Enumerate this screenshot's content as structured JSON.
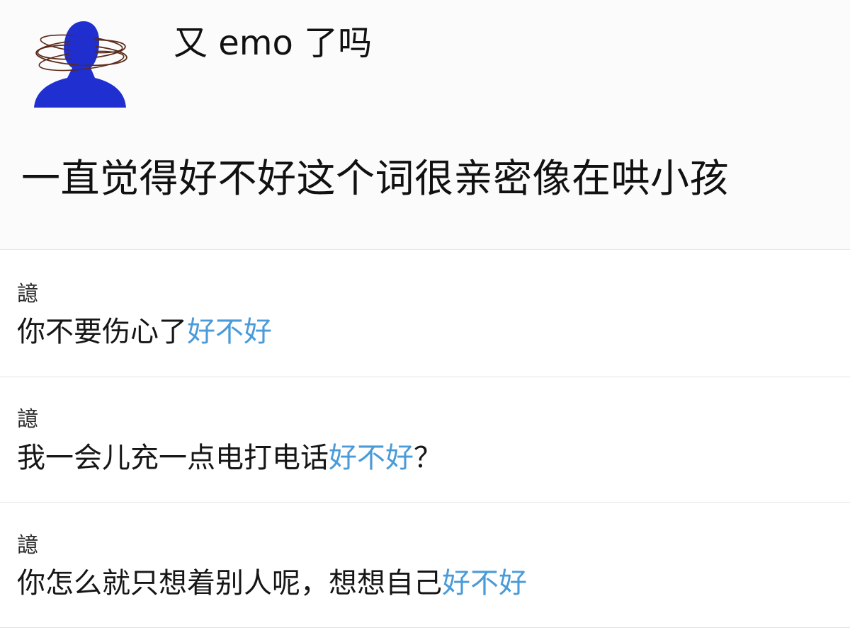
{
  "post": {
    "title": "又 emo 了吗",
    "text": "一直觉得好不好这个词很亲密像在哄小孩"
  },
  "colors": {
    "highlight": "#4a9bd9",
    "avatar": "#1f2fd0"
  },
  "avatar_icon": "blue-figure-with-orbit-scribbles",
  "replies": [
    {
      "author": "譩",
      "segments": [
        {
          "text": "你不要伤心了",
          "highlight": false
        },
        {
          "text": "好不好",
          "highlight": true
        }
      ]
    },
    {
      "author": "譩",
      "segments": [
        {
          "text": "我一会儿充一点电打电话",
          "highlight": false
        },
        {
          "text": "好不好",
          "highlight": true
        },
        {
          "text": "？",
          "highlight": false
        }
      ]
    },
    {
      "author": "譩",
      "segments": [
        {
          "text": "你怎么就只想着别人呢，想想自己",
          "highlight": false
        },
        {
          "text": "好不好",
          "highlight": true
        }
      ]
    }
  ]
}
